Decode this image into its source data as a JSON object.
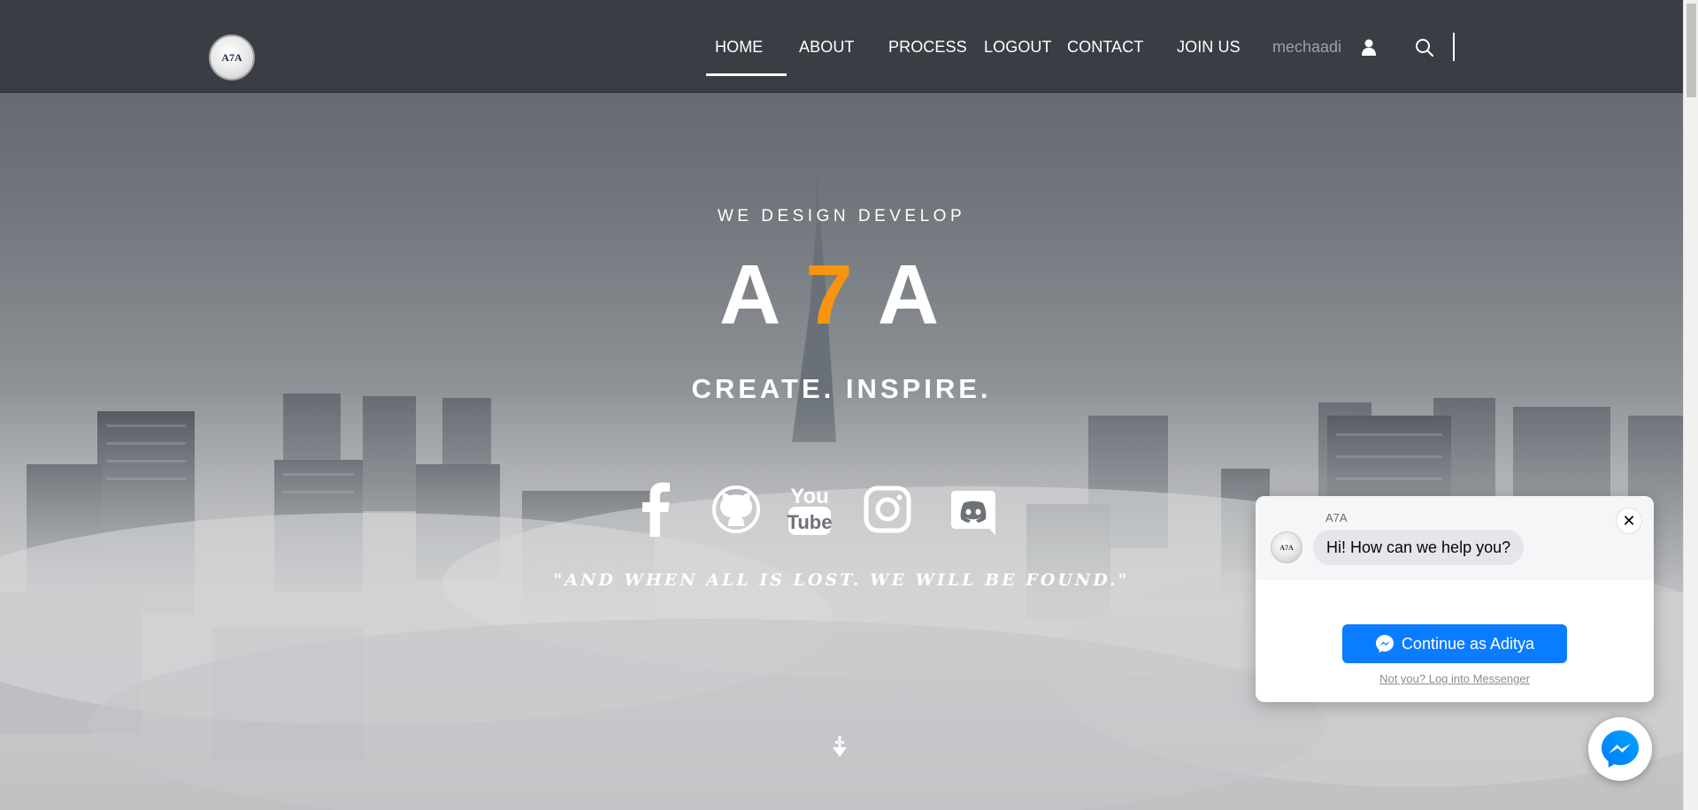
{
  "navbar": {
    "logo_text": "A7A",
    "items": [
      {
        "label": "HOME",
        "active": true
      },
      {
        "label": "ABOUT"
      },
      {
        "label": "PROCESS"
      },
      {
        "label": "LOGOUT"
      },
      {
        "label": "CONTACT"
      },
      {
        "label": "JOIN US"
      }
    ],
    "username": "mechaadi",
    "icons": [
      "user-icon",
      "search-icon"
    ]
  },
  "hero": {
    "kicker": "WE DESIGN DEVELOP",
    "brand": {
      "part1": "A",
      "part2": "7",
      "part3": "A"
    },
    "tagline": "CREATE. INSPIRE.",
    "quote": "\"AND WHEN ALL IS LOST. WE WILL BE FOUND.\"",
    "socials": [
      "facebook-icon",
      "github-icon",
      "youtube-icon",
      "instagram-icon",
      "discord-icon"
    ],
    "accent_color": "#f7950f"
  },
  "chat": {
    "sender": "A7A",
    "avatar_text": "A7A",
    "message": "Hi! How can we help you?",
    "close_label": "✕",
    "continue_label": "Continue as Aditya",
    "login_link": "Not you? Log into Messenger",
    "button_color": "#0a7cff"
  }
}
